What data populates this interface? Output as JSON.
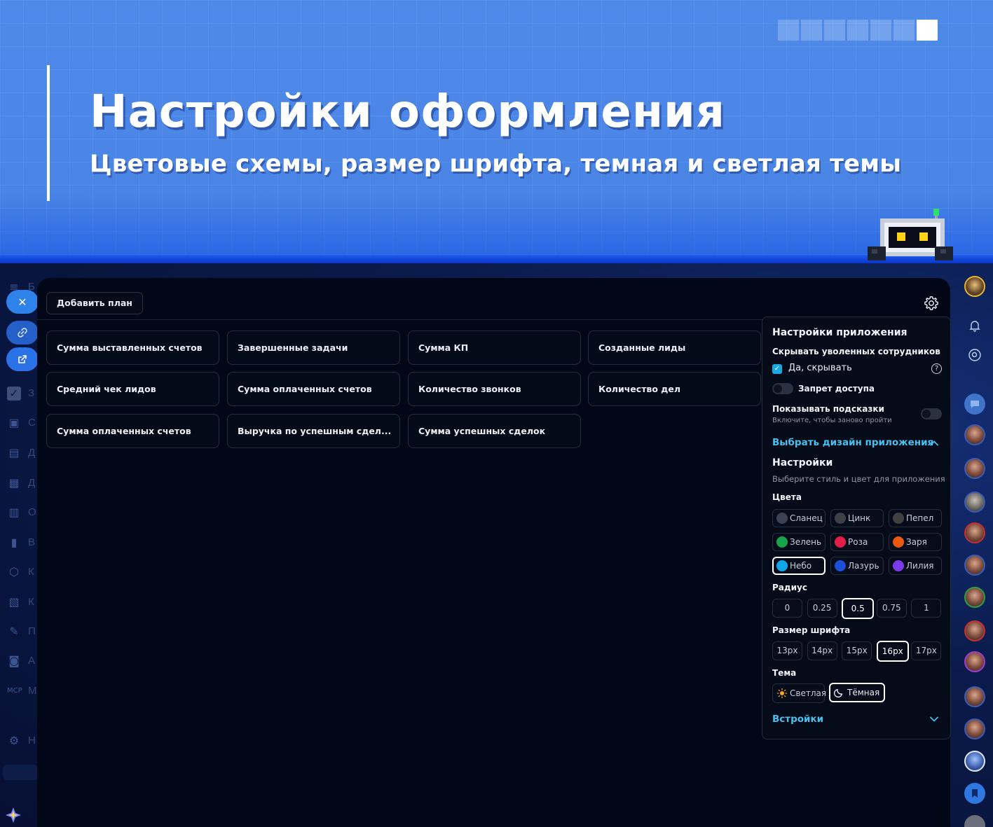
{
  "hero": {
    "title": "Настройки оформления",
    "subtitle": "Цветовые схемы, размер шрифта, темная и светлая темы",
    "pager_active": 7
  },
  "toolbar": {
    "add_plan_label": "Добавить план"
  },
  "cards": [
    "Сумма выставленных счетов",
    "Завершенные задачи",
    "Сумма КП",
    "Созданные лиды",
    "Средний чек лидов",
    "Сумма оплаченных счетов",
    "Количество звонков",
    "Количество дел",
    "Сумма оплаченных счетов",
    "Выручка по успешным сдел...",
    "Сумма успешных сделок"
  ],
  "settings": {
    "title": "Настройки приложения",
    "hide_fired_label": "Скрывать уволенных сотрудников",
    "hide_fired_option": "Да, скрывать",
    "hide_fired_checked": true,
    "access_ban_label": "Запрет доступа",
    "access_ban_on": false,
    "hints_label": "Показывать подсказки",
    "hints_desc": "Включите, чтобы заново пройти",
    "hints_on": false,
    "design_link": "Выбрать дизайн приложения",
    "design_section_title": "Настройки",
    "design_section_desc": "Выберите стиль и цвет для приложения",
    "colors_label": "Цвета",
    "colors": [
      {
        "name": "Сланец",
        "color": "#3b4353"
      },
      {
        "name": "Цинк",
        "color": "#3f3f46"
      },
      {
        "name": "Пепел",
        "color": "#404040"
      },
      {
        "name": "Зелень",
        "color": "#16a34a"
      },
      {
        "name": "Роза",
        "color": "#e11d48"
      },
      {
        "name": "Заря",
        "color": "#ea580c"
      },
      {
        "name": "Небо",
        "color": "#0ea5e9"
      },
      {
        "name": "Лазурь",
        "color": "#1d4ed8"
      },
      {
        "name": "Лилия",
        "color": "#7c3aed"
      }
    ],
    "selected_color": "Небо",
    "radius_label": "Радиус",
    "radius_options": [
      "0",
      "0.25",
      "0.5",
      "0.75",
      "1"
    ],
    "selected_radius": "0.5",
    "font_size_label": "Размер шрифта",
    "font_size_options": [
      "13px",
      "14px",
      "15px",
      "16px",
      "17px"
    ],
    "selected_font_size": "16px",
    "theme_label": "Тема",
    "theme_light": "Светлая",
    "theme_dark": "Тёмная",
    "selected_theme": "Тёмная",
    "embeds_link": "Встройки"
  },
  "left_rail": {
    "menu_letter": "Б",
    "item_letters": [
      "З",
      "С",
      "Д",
      "Д",
      "О",
      "В",
      "К",
      "К",
      "П",
      "А",
      "М",
      "Н"
    ],
    "mcp_label": "MCP"
  },
  "colors": {
    "accent": "#46c1f0",
    "panel_bg": "#010716",
    "hero_bg": "#4f8ae9"
  }
}
